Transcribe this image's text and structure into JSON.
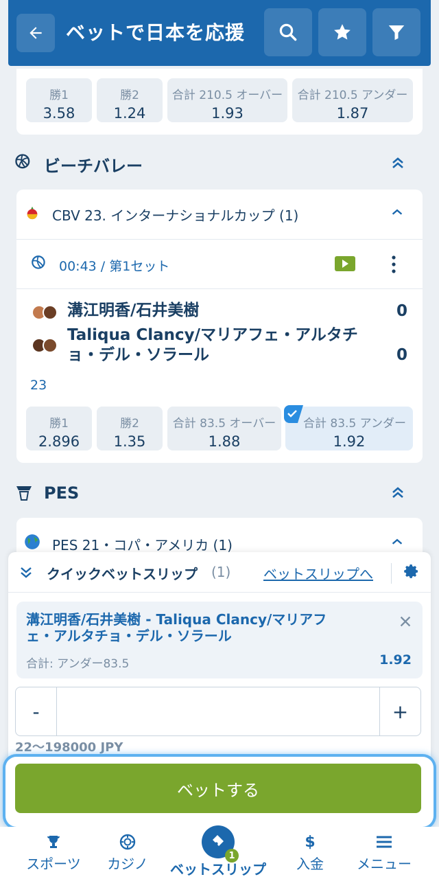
{
  "header": {
    "title": "ベットで日本を応援"
  },
  "prev_match_odds": [
    {
      "label": "勝1",
      "value": "3.58"
    },
    {
      "label": "勝2",
      "value": "1.24"
    },
    {
      "label": "合計 210.5 オーバー",
      "value": "1.93"
    },
    {
      "label": "合計 210.5 アンダー",
      "value": "1.87"
    }
  ],
  "beach": {
    "section_title": "ビーチバレー",
    "league": "CBV 23. インターナショナルカップ (1)",
    "time": "00:43 / 第1セット",
    "team1": "溝江明香/石井美樹",
    "team2": "Taliqua Clancy/マリアフェ・アルタチョ・デル・ソラール",
    "score1": "0",
    "score2": "0",
    "extra": "23",
    "odds": [
      {
        "label": "勝1",
        "value": "2.896"
      },
      {
        "label": "勝2",
        "value": "1.35"
      },
      {
        "label": "合計 83.5 オーバー",
        "value": "1.88"
      },
      {
        "label": "合計 83.5 アンダー",
        "value": "1.92"
      }
    ]
  },
  "pes": {
    "section_title": "PES",
    "league": "PES 21・コパ・アメリカ (1)"
  },
  "slip": {
    "title": "クイックベットスリップ",
    "count": "(1)",
    "link": "ベットスリップへ",
    "event": "溝江明香/石井美樹 - Taliqua Clancy/マリアフェ・アルタチョ・デル・ソラール",
    "market": "合計: アンダー83.5",
    "odd": "1.92",
    "minus": "-",
    "plus": "+",
    "range": "22～198000 JPY",
    "bet_button": "ベットする"
  },
  "nav": {
    "sports": "スポーツ",
    "casino": "カジノ",
    "betslip": "ベットスリップ",
    "badge": "1",
    "deposit": "入金",
    "menu": "メニュー"
  },
  "colors": {
    "primary": "#1c68ad",
    "accent_green": "#7aa62d",
    "background": "#ecf0f4"
  }
}
